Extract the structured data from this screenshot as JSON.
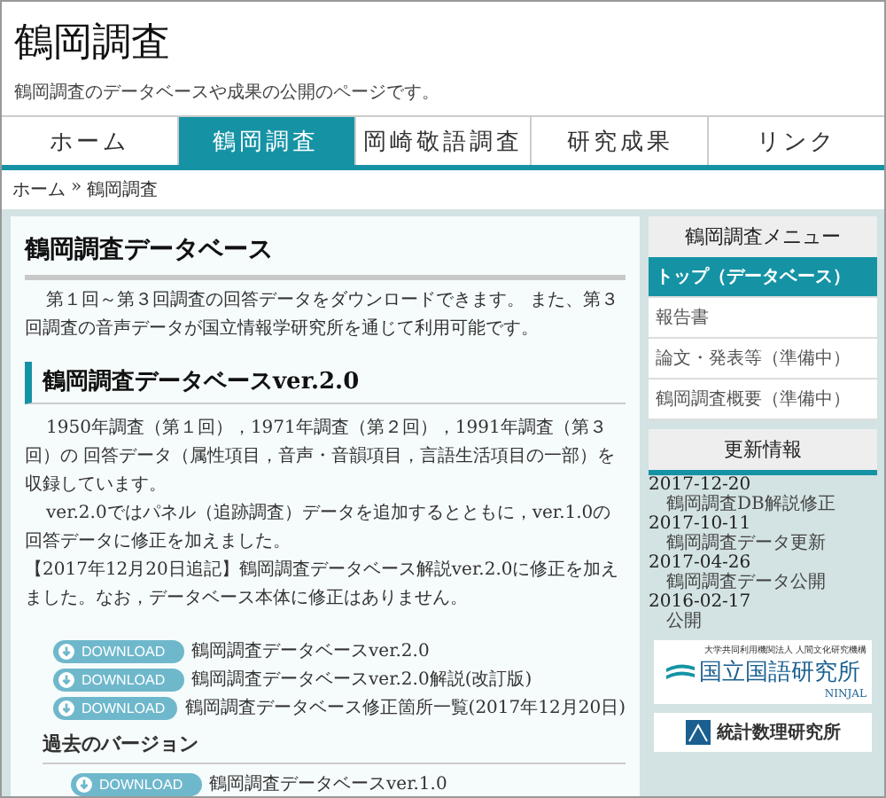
{
  "site": {
    "title": "鶴岡調査",
    "subtitle": "鶴岡調査のデータベースや成果の公開のページです。"
  },
  "tabs": [
    {
      "label": "ホーム",
      "selected": false
    },
    {
      "label": "鶴岡調査",
      "selected": true
    },
    {
      "label": "岡崎敬語調査",
      "selected": false
    },
    {
      "label": "研究成果",
      "selected": false
    },
    {
      "label": "リンク",
      "selected": false
    }
  ],
  "breadcrumb": {
    "items": [
      "ホーム",
      "鶴岡調査"
    ],
    "separator": "»"
  },
  "main": {
    "title": "鶴岡調査データベース",
    "intro": "第１回～第３回調査の回答データをダウンロードできます。 また、第３回調査の音声データが国立情報学研究所を通じて利用可能です。",
    "section_title": "鶴岡調査データベースver.2.0",
    "paragraphs": [
      "1950年調査（第１回），1971年調査（第２回），1991年調査（第３回）の 回答データ（属性項目，音声・音韻項目，言語生活項目の一部）を収録しています。",
      "ver.2.0ではパネル（追跡調査）データを追加するとともに，ver.1.0の回答データに修正を加えました。",
      "【2017年12月20日追記】鶴岡調査データベース解説ver.2.0に修正を加えました。なお，データベース本体に修正はありません。"
    ],
    "downloads": [
      {
        "button": "DOWNLOAD",
        "label": "鶴岡調査データベースver.2.0"
      },
      {
        "button": "DOWNLOAD",
        "label": "鶴岡調査データベースver.2.0解説(改訂版)"
      },
      {
        "button": "DOWNLOAD",
        "label": "鶴岡調査データベース修正箇所一覧(2017年12月20日)"
      }
    ],
    "past_title": "過去のバージョン",
    "past_downloads": [
      {
        "button": "DOWNLOAD",
        "label": "鶴岡調査データベースver.1.0"
      }
    ]
  },
  "sidebar": {
    "menu_title": "鶴岡調査メニュー",
    "menu": [
      {
        "label": "トップ（データベース）",
        "selected": true
      },
      {
        "label": "報告書",
        "selected": false
      },
      {
        "label": "論文・発表等（準備中）",
        "selected": false
      },
      {
        "label": "鶴岡調査概要（準備中）",
        "selected": false
      }
    ],
    "updates_title": "更新情報",
    "updates": [
      {
        "date": "2017-12-20",
        "text": "鶴岡調査DB解説修正"
      },
      {
        "date": "2017-10-11",
        "text": "鶴岡調査データ更新"
      },
      {
        "date": "2017-04-26",
        "text": "鶴岡調査データ公開"
      },
      {
        "date": "2016-02-17",
        "text": "公開"
      }
    ],
    "banners": [
      {
        "kind": "ninjal",
        "top": "大学共同利用機関法人 人間文化研究機構",
        "name": "国立国語研究所",
        "tag": "NINJAL"
      },
      {
        "kind": "ism",
        "name": "統計数理研究所"
      }
    ]
  }
}
